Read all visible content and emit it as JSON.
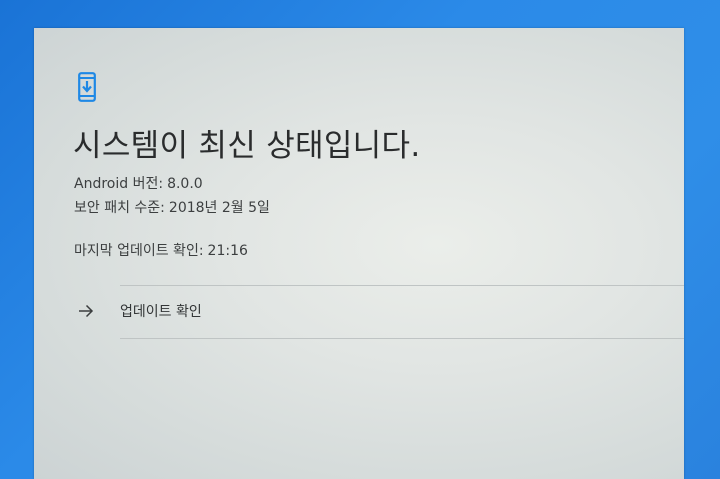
{
  "status": {
    "icon": "system-update-phone-icon",
    "title": "시스템이 최신 상태입니다."
  },
  "details": {
    "android_version_label": "Android 버전:",
    "android_version_value": "8.0.0",
    "security_patch_label": "보안 패치 수준:",
    "security_patch_value": "2018년 2월 5일",
    "last_check_label": "마지막 업데이트 확인:",
    "last_check_value": "21:16"
  },
  "actions": {
    "check_update_label": "업데이트 확인",
    "check_update_icon": "arrow-right-icon"
  },
  "colors": {
    "accent": "#1e88e5",
    "screen_bg": "#e1e5e3",
    "text_primary": "#2a2c2d"
  }
}
